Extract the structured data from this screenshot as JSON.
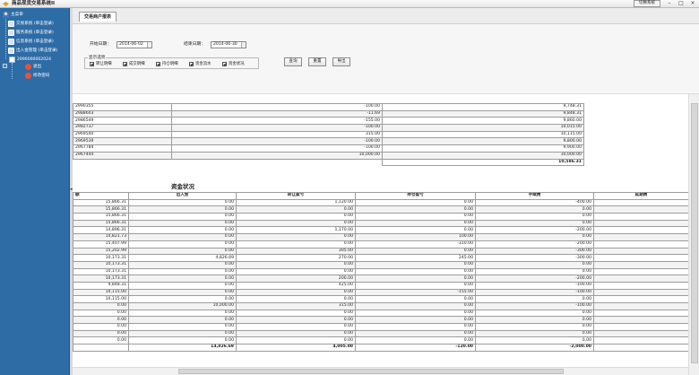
{
  "app": {
    "title": "商品现货交易系统II",
    "switch_system": "切换系统",
    "win_minimize": "–",
    "win_maximize": "□",
    "win_close": "×"
  },
  "sidebar": {
    "items": [
      {
        "label": "主菜单"
      },
      {
        "label": "交易系统 (单击登录)"
      },
      {
        "label": "服务系统 (单击登录)"
      },
      {
        "label": "信息系统 (单击登录)"
      },
      {
        "label": "出入金管理 (单击登录)"
      },
      {
        "label": "2990000002024"
      },
      {
        "label": "退出"
      },
      {
        "label": "修改密码"
      }
    ],
    "toggle": "−"
  },
  "tab": {
    "label": "交易商户报表"
  },
  "filter": {
    "start_label": "开始日期：",
    "start_value": "2014-06-02",
    "end_label": "结束日期：",
    "end_value": "2014-06-30",
    "options_legend": "显示选项",
    "options": [
      "转让明细",
      "成交明细",
      "持仓明细",
      "资金流水",
      "资金状况"
    ],
    "query_button": "查询",
    "reset_button": "重置",
    "export_button": "导出"
  },
  "flow_table": {
    "rows": [
      {
        "id": "2990355",
        "amount": "-100.00",
        "balance": "9,748.31"
      },
      {
        "id": "2988603",
        "amount": "-11.69",
        "balance": "9,848.31"
      },
      {
        "id": "2986549",
        "amount": "-155.00",
        "balance": "9,860.00"
      },
      {
        "id": "2982737",
        "amount": "-100.00",
        "balance": "10,015.00"
      },
      {
        "id": "2969540",
        "amount": "315.00",
        "balance": "10,115.00"
      },
      {
        "id": "2969539",
        "amount": "-100.00",
        "balance": "9,800.00"
      },
      {
        "id": "2967784",
        "amount": "-100.00",
        "balance": "9,900.00"
      },
      {
        "id": "2967444",
        "amount": "10,000.00",
        "balance": "10,000.00"
      }
    ],
    "total": "10,586.31"
  },
  "funds": {
    "title": "资金状况",
    "headers": [
      "额",
      "出入金",
      "转让盈亏",
      "持仓盈亏",
      "手续费",
      "延期费"
    ],
    "rows": [
      [
        "15,866.31",
        "0.00",
        "1,120.00",
        "0.00",
        "-400.00",
        ""
      ],
      [
        "15,866.31",
        "0.00",
        "0.00",
        "0.00",
        "0.00",
        ""
      ],
      [
        "15,866.31",
        "0.00",
        "0.00",
        "0.00",
        "0.00",
        ""
      ],
      [
        "15,866.31",
        "0.00",
        "0.00",
        "0.00",
        "0.00",
        ""
      ],
      [
        "14,896.31",
        "0.00",
        "1,170.00",
        "0.00",
        "-200.00",
        ""
      ],
      [
        "14,821.73",
        "0.00",
        "0.00",
        "100.00",
        "0.00",
        ""
      ],
      [
        "15,407.99",
        "0.00",
        "0.00",
        "-310.00",
        "-200.00",
        ""
      ],
      [
        "15,202.99",
        "0.00",
        "305.00",
        "0.00",
        "-300.00",
        ""
      ],
      [
        "10,173.31",
        "4,826.69",
        "270.00",
        "245.00",
        "-300.00",
        ""
      ],
      [
        "10,173.31",
        "0.00",
        "0.00",
        "0.00",
        "0.00",
        ""
      ],
      [
        "10,173.31",
        "0.00",
        "0.00",
        "0.00",
        "0.00",
        ""
      ],
      [
        "10,173.31",
        "0.00",
        "200.00",
        "0.00",
        "-200.00",
        ""
      ],
      [
        "9,848.31",
        "0.00",
        "425.00",
        "0.00",
        "-100.00",
        ""
      ],
      [
        "10,115.00",
        "0.00",
        "0.00",
        "-155.00",
        "-100.00",
        ""
      ],
      [
        "10,115.00",
        "0.00",
        "0.00",
        "0.00",
        "0.00",
        ""
      ],
      [
        "0.00",
        "10,000.00",
        "315.00",
        "0.00",
        "-100.00",
        ""
      ],
      [
        "0.00",
        "0.00",
        "0.00",
        "0.00",
        "0.00",
        ""
      ],
      [
        "0.00",
        "0.00",
        "0.00",
        "0.00",
        "0.00",
        ""
      ],
      [
        "0.00",
        "0.00",
        "0.00",
        "0.00",
        "0.00",
        ""
      ],
      [
        "0.00",
        "0.00",
        "0.00",
        "0.00",
        "0.00",
        ""
      ],
      [
        "0.00",
        "0.00",
        "0.00",
        "0.00",
        "0.00",
        ""
      ]
    ],
    "totals": [
      "",
      "14,826.69",
      "4,005.00",
      "-120.00",
      "-2,000.00",
      ""
    ]
  }
}
